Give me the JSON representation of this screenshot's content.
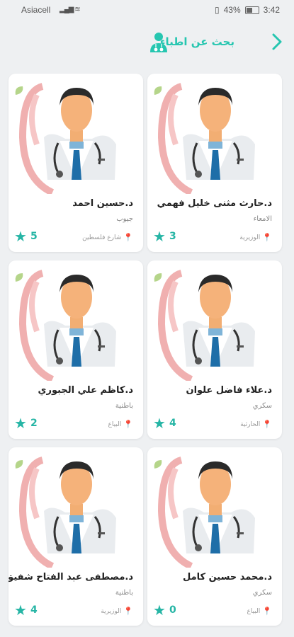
{
  "status": {
    "carrier": "Asiacell",
    "battery": "43%",
    "time": "3:42"
  },
  "header": {
    "title": "بحث عن اطباء",
    "back_icon": "chevron-right-icon",
    "doctor_icon": "doctor-search-icon",
    "accent": "#26c6b0"
  },
  "doctors": [
    {
      "name": "د.حارث مثنى خليل فهمي",
      "specialty": "الامعاء",
      "location": "الوزيرية",
      "rating": "3"
    },
    {
      "name": "د.حسين احمد",
      "specialty": "جيوب",
      "location": "شارع فلسطين",
      "rating": "5"
    },
    {
      "name": "د.علاء فاضل علوان",
      "specialty": "سكري",
      "location": "الحارثية",
      "rating": "4"
    },
    {
      "name": "د.كاظم علي الجبوري",
      "specialty": "باطنية",
      "location": "البياع",
      "rating": "2"
    },
    {
      "name": "د.محمد حسين كامل",
      "specialty": "سكري",
      "location": "البياع",
      "rating": "0"
    },
    {
      "name": "د.مصطفى عبد الفتاح شفيق",
      "specialty": "باطنية",
      "location": "الوزيرية",
      "rating": "4"
    }
  ]
}
